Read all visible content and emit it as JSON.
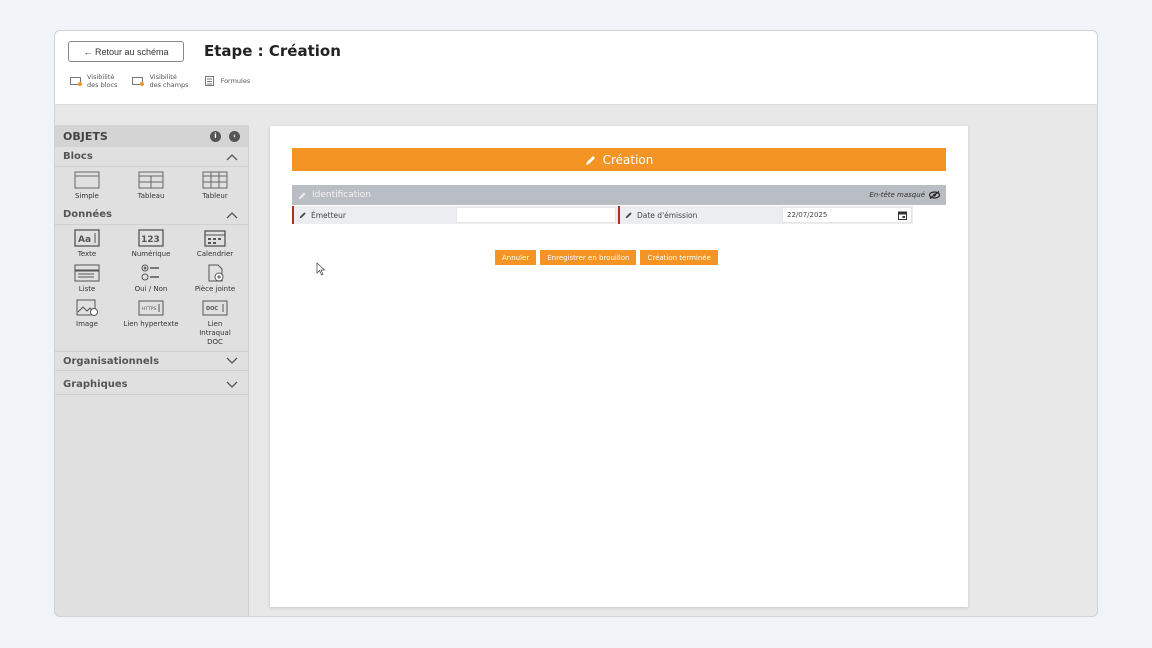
{
  "header": {
    "back_label": "← Retour au schéma",
    "title": "Etape : Création",
    "tools": [
      {
        "label1": "Visibilité",
        "label2": "des blocs",
        "icon": "block-visibility-icon"
      },
      {
        "label1": "Visibilité",
        "label2": "des champs",
        "icon": "field-visibility-icon"
      },
      {
        "label1": "Formules",
        "label2": "",
        "icon": "formula-icon"
      }
    ]
  },
  "sidebar": {
    "title": "OBJETS",
    "sections": {
      "blocs": "Blocs",
      "donnees": "Données",
      "organisationnels": "Organisationnels",
      "graphiques": "Graphiques"
    },
    "blocs_items": [
      "Simple",
      "Tableau",
      "Tableur"
    ],
    "donnees_items": [
      "Texte",
      "Numérique",
      "Calendrier",
      "Liste",
      "Oui / Non",
      "Pièce jointe",
      "Image",
      "Lien hypertexte",
      "Lien Intraqual DOC"
    ]
  },
  "form": {
    "banner": "Création",
    "section": "Identification",
    "header_hidden": "En-tête masqué",
    "fields": {
      "emetteur_label": "Émetteur",
      "emetteur_value": "",
      "date_label": "Date d'émission",
      "date_value": "22/07/2025"
    },
    "buttons": [
      "Annuler",
      "Enregistrer en brouillon",
      "Création terminée"
    ]
  },
  "colors": {
    "accent": "#f39425",
    "required": "#b03020"
  }
}
